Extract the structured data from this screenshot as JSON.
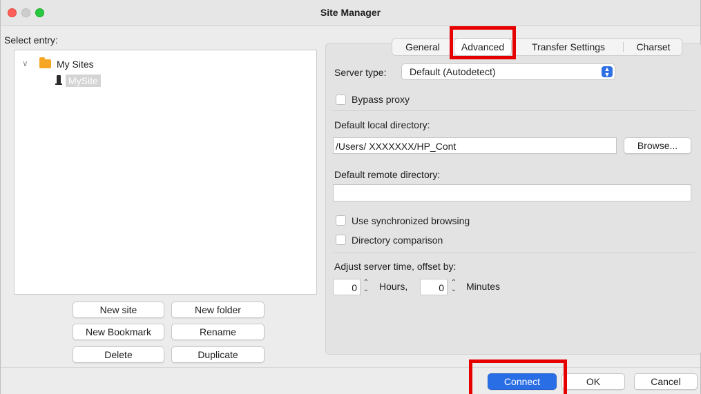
{
  "window": {
    "title": "Site Manager"
  },
  "left": {
    "select_label": "Select entry:",
    "tree": {
      "folder_label": "My Sites",
      "site_label": "MySite"
    },
    "buttons": {
      "new_site": "New site",
      "new_folder": "New folder",
      "new_bookmark": "New Bookmark",
      "rename": "Rename",
      "delete": "Delete",
      "duplicate": "Duplicate"
    }
  },
  "tabs": {
    "general": "General",
    "advanced": "Advanced",
    "transfer": "Transfer Settings",
    "charset": "Charset",
    "active": "Advanced"
  },
  "advanced": {
    "server_type_label": "Server type:",
    "server_type_value": "Default (Autodetect)",
    "bypass_proxy": "Bypass proxy",
    "bypass_proxy_checked": false,
    "local_dir_label": "Default local directory:",
    "local_dir_value": "/Users/ XXXXXXX/HP_Cont",
    "browse": "Browse...",
    "remote_dir_label": "Default remote directory:",
    "remote_dir_value": "",
    "sync_browsing": "Use synchronized browsing",
    "sync_browsing_checked": false,
    "dir_comparison": "Directory comparison",
    "dir_comparison_checked": false,
    "offset_label": "Adjust server time, offset by:",
    "hours_value": "0",
    "hours_label": "Hours,",
    "minutes_value": "0",
    "minutes_label": "Minutes"
  },
  "footer": {
    "connect": "Connect",
    "ok": "OK",
    "cancel": "Cancel"
  },
  "colors": {
    "highlight_box": "#e60000",
    "primary_button": "#2a6ee6",
    "folder": "#f6a623"
  }
}
